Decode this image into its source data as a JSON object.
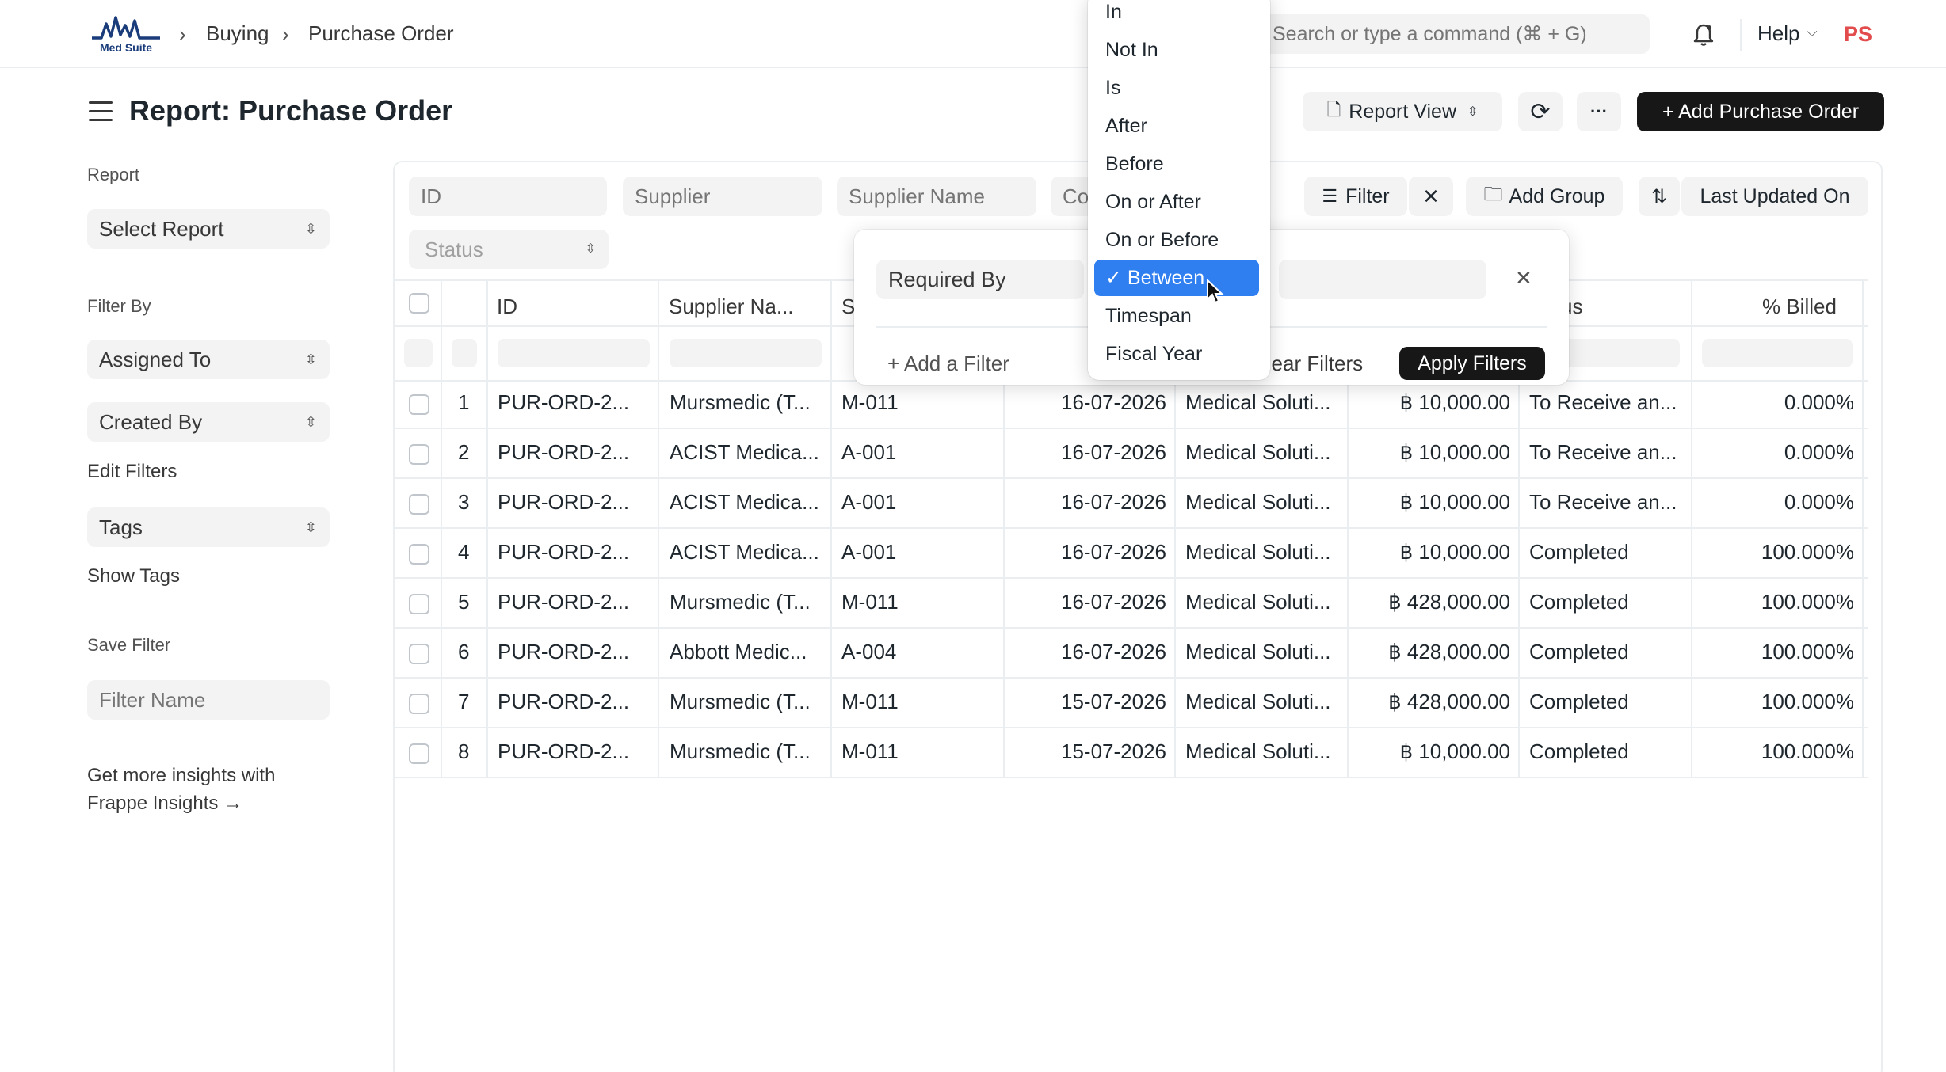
{
  "navbar": {
    "logo_text": "Med Suite",
    "breadcrumbs": [
      "Buying",
      "Purchase Order"
    ],
    "search_placeholder": "Search or type a command (⌘ + G)",
    "help_label": "Help",
    "avatar_initials": "PS"
  },
  "page": {
    "title": "Report: Purchase Order",
    "report_view_label": "Report View",
    "more_label": "···",
    "add_label": "+ Add Purchase Order"
  },
  "sidebar": {
    "report_label": "Report",
    "select_report": "Select Report",
    "filter_by_label": "Filter By",
    "assigned_to": "Assigned To",
    "created_by": "Created By",
    "edit_filters": "Edit Filters",
    "tags": "Tags",
    "show_tags": "Show Tags",
    "save_filter_label": "Save Filter",
    "filter_name_placeholder": "Filter Name",
    "insights_line1": "Get more insights with",
    "insights_line2": "Frappe Insights →"
  },
  "toolbar": {
    "id_placeholder": "ID",
    "supplier_placeholder": "Supplier",
    "supplier_name_placeholder": "Supplier Name",
    "company_placeholder": "Co",
    "status_placeholder": "Status",
    "filter_label": "Filter",
    "add_group_label": "Add Group",
    "sort_label": "Last Updated On"
  },
  "table": {
    "columns": [
      "ID",
      "Supplier Na...",
      "S",
      "us",
      "% Billed"
    ],
    "rows": [
      {
        "n": "1",
        "id": "PUR-ORD-2...",
        "supplier": "Mursmedic (T...",
        "code": "M-011",
        "date": "16-07-2026",
        "company": "Medical Soluti...",
        "amount": "฿ 10,000.00",
        "status": "To Receive an...",
        "billed": "0.000%"
      },
      {
        "n": "2",
        "id": "PUR-ORD-2...",
        "supplier": "ACIST Medica...",
        "code": "A-001",
        "date": "16-07-2026",
        "company": "Medical Soluti...",
        "amount": "฿ 10,000.00",
        "status": "To Receive an...",
        "billed": "0.000%"
      },
      {
        "n": "3",
        "id": "PUR-ORD-2...",
        "supplier": "ACIST Medica...",
        "code": "A-001",
        "date": "16-07-2026",
        "company": "Medical Soluti...",
        "amount": "฿ 10,000.00",
        "status": "To Receive an...",
        "billed": "0.000%"
      },
      {
        "n": "4",
        "id": "PUR-ORD-2...",
        "supplier": "ACIST Medica...",
        "code": "A-001",
        "date": "16-07-2026",
        "company": "Medical Soluti...",
        "amount": "฿ 10,000.00",
        "status": "Completed",
        "billed": "100.000%"
      },
      {
        "n": "5",
        "id": "PUR-ORD-2...",
        "supplier": "Mursmedic (T...",
        "code": "M-011",
        "date": "16-07-2026",
        "company": "Medical Soluti...",
        "amount": "฿ 428,000.00",
        "status": "Completed",
        "billed": "100.000%"
      },
      {
        "n": "6",
        "id": "PUR-ORD-2...",
        "supplier": "Abbott Medic...",
        "code": "A-004",
        "date": "16-07-2026",
        "company": "Medical Soluti...",
        "amount": "฿ 428,000.00",
        "status": "Completed",
        "billed": "100.000%"
      },
      {
        "n": "7",
        "id": "PUR-ORD-2...",
        "supplier": "Mursmedic (T...",
        "code": "M-011",
        "date": "15-07-2026",
        "company": "Medical Soluti...",
        "amount": "฿ 428,000.00",
        "status": "Completed",
        "billed": "100.000%"
      },
      {
        "n": "8",
        "id": "PUR-ORD-2...",
        "supplier": "Mursmedic (T...",
        "code": "M-011",
        "date": "15-07-2026",
        "company": "Medical Soluti...",
        "amount": "฿ 10,000.00",
        "status": "Completed",
        "billed": "100.000%"
      }
    ]
  },
  "filter_popover": {
    "field": "Required By",
    "add_filter": "+ Add a Filter",
    "clear_filters": "Clear Filters",
    "apply_filters": "Apply Filters"
  },
  "condition_dropdown": {
    "options": [
      "In",
      "Not In",
      "Is",
      "After",
      "Before",
      "On or After",
      "On or Before",
      "Between",
      "Timespan",
      "Fiscal Year"
    ],
    "selected": "✓ Between"
  },
  "colors": {
    "accent": "#2f7ff0",
    "dark_button": "#171717",
    "avatar": "#e24c4c"
  }
}
